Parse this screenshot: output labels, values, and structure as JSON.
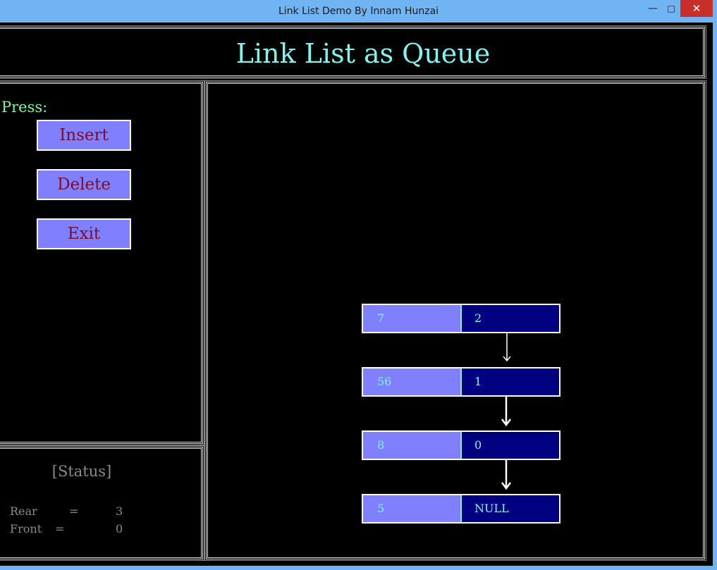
{
  "window": {
    "title": "Link List Demo By Innam Hunzai"
  },
  "header": {
    "title": "Link List as Queue"
  },
  "menu": {
    "prompt": "Press:",
    "buttons": [
      {
        "label": "Insert"
      },
      {
        "label": "Delete"
      },
      {
        "label": "Exit"
      }
    ]
  },
  "status": {
    "title": "[Status]",
    "rear_label": "Rear",
    "front_label": "Front",
    "eq": "=",
    "rear": "3",
    "front": "0"
  },
  "queue": {
    "nodes": [
      {
        "data": "7",
        "next": "2"
      },
      {
        "data": "56",
        "next": "1"
      },
      {
        "data": "8",
        "next": "0"
      },
      {
        "data": "5",
        "next": "NULL"
      }
    ]
  },
  "icons": {
    "minimize": "minimize-icon",
    "maximize": "maximize-icon",
    "close": "close-icon"
  },
  "colors": {
    "title": "#7ff4f0",
    "button_bg": "#8080ff",
    "button_text": "#7d0c2c",
    "node_next_bg": "#000080",
    "titlebar": "#71b4f4"
  }
}
